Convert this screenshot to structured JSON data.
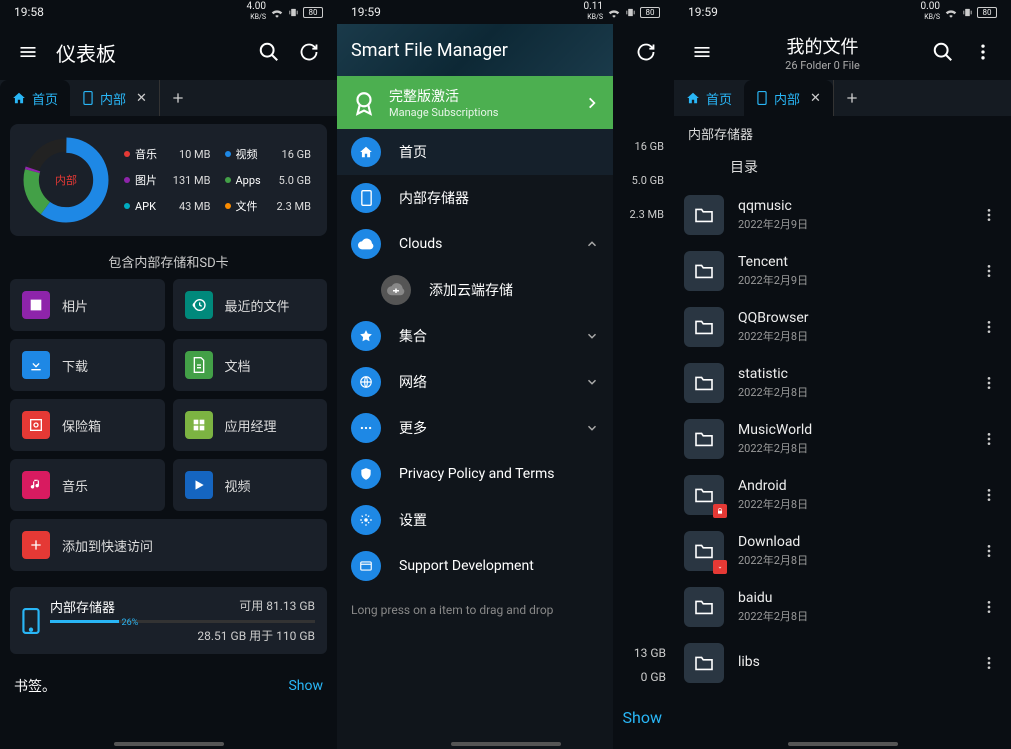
{
  "s1": {
    "status": {
      "time": "19:58",
      "net": "4.00",
      "net_unit": "KB/S",
      "batt": "80"
    },
    "title": "仪表板",
    "tabs": [
      {
        "icon": "home",
        "label": "首页",
        "active": true
      },
      {
        "icon": "phone",
        "label": "内部",
        "closable": true
      }
    ],
    "donut_label": "内部",
    "legend": [
      {
        "color": "#e53935",
        "name": "音乐",
        "val": "10 MB"
      },
      {
        "color": "#1e88e5",
        "name": "视频",
        "val": "16 GB"
      },
      {
        "color": "#8e24aa",
        "name": "图片",
        "val": "131 MB"
      },
      {
        "color": "#43a047",
        "name": "Apps",
        "val": "5.0 GB"
      },
      {
        "color": "#00acc1",
        "name": "APK",
        "val": "43 MB"
      },
      {
        "color": "#fb8c00",
        "name": "文件",
        "val": "2.3 MB"
      }
    ],
    "section_title": "包含内部存储和SD卡",
    "tiles": [
      {
        "bg": "#8e24aa",
        "name": "相片",
        "icon": "image"
      },
      {
        "bg": "#00897b",
        "name": "最近的文件",
        "icon": "history"
      },
      {
        "bg": "#1e88e5",
        "name": "下载",
        "icon": "download"
      },
      {
        "bg": "#43a047",
        "name": "文档",
        "icon": "doc"
      },
      {
        "bg": "#e53935",
        "name": "保险箱",
        "icon": "safe"
      },
      {
        "bg": "#7cb342",
        "name": "应用经理",
        "icon": "apps"
      },
      {
        "bg": "#d81b60",
        "name": "音乐",
        "icon": "music"
      },
      {
        "bg": "#1565c0",
        "name": "视频",
        "icon": "play"
      },
      {
        "bg": "#e53935",
        "name": "添加到快速访问",
        "icon": "add",
        "full": true
      }
    ],
    "storage": {
      "title": "内部存储器",
      "avail": "可用 81.13 GB",
      "pct": 26,
      "pct_label": "26%",
      "used": "28.51 GB 用于 110 GB"
    },
    "bookmark_label": "书签。",
    "show": "Show"
  },
  "s2": {
    "status": {
      "time": "19:59",
      "net": "0.11",
      "net_unit": "KB/S",
      "batt": "80"
    },
    "header": "Smart File Manager",
    "banner": {
      "title": "完整版激活",
      "sub": "Manage Subscriptions"
    },
    "items": [
      {
        "type": "home",
        "label": "首页",
        "sel": true,
        "color": "#1e88e5"
      },
      {
        "type": "phone",
        "label": "内部存储器",
        "color": "#1e88e5"
      },
      {
        "type": "cloud",
        "label": "Clouds",
        "color": "#1e88e5",
        "expand": "up"
      },
      {
        "type": "cloud-add",
        "label": "添加云端存储",
        "sub": true,
        "color": "#555"
      },
      {
        "type": "collection",
        "label": "集合",
        "color": "#1e88e5",
        "expand": "down"
      },
      {
        "type": "network",
        "label": "网络",
        "color": "#1e88e5",
        "expand": "down"
      },
      {
        "type": "more",
        "label": "更多",
        "color": "#1e88e5",
        "expand": "down"
      },
      {
        "type": "privacy",
        "label": "Privacy Policy and Terms",
        "color": "#1e88e5"
      },
      {
        "type": "settings",
        "label": "设置",
        "color": "#1e88e5"
      },
      {
        "type": "support",
        "label": "Support Development",
        "color": "#1e88e5"
      }
    ],
    "hint": "Long press on a item to drag and drop",
    "right_vals": [
      "16 GB",
      "5.0 GB",
      "2.3 MB"
    ],
    "right_storage": [
      "13 GB",
      "0 GB"
    ],
    "right_show": "Show"
  },
  "s3": {
    "status": {
      "time": "19:59",
      "net": "0.00",
      "net_unit": "KB/S",
      "batt": "80"
    },
    "title": "我的文件",
    "subtitle": "26 Folder 0 File",
    "tabs": [
      {
        "icon": "home",
        "label": "首页"
      },
      {
        "icon": "phone",
        "label": "内部",
        "active": true,
        "closable": true
      }
    ],
    "crumb": "内部存储器",
    "list_header": "目录",
    "folders": [
      {
        "name": "qqmusic",
        "date": "2022年2月9日"
      },
      {
        "name": "Tencent",
        "date": "2022年2月9日"
      },
      {
        "name": "QQBrowser",
        "date": "2022年2月8日"
      },
      {
        "name": "statistic",
        "date": "2022年2月8日"
      },
      {
        "name": "MusicWorld",
        "date": "2022年2月8日"
      },
      {
        "name": "Android",
        "date": "2022年2月8日",
        "badge": "lock"
      },
      {
        "name": "Download",
        "date": "2022年2月8日",
        "badge": "down"
      },
      {
        "name": "baidu",
        "date": "2022年2月8日"
      },
      {
        "name": "libs",
        "date": ""
      }
    ]
  },
  "chart_data": {
    "type": "pie",
    "title": "内部",
    "series": [
      {
        "name": "音乐",
        "value_label": "10 MB",
        "value_mb": 10,
        "color": "#e53935"
      },
      {
        "name": "视频",
        "value_label": "16 GB",
        "value_mb": 16384,
        "color": "#1e88e5"
      },
      {
        "name": "图片",
        "value_label": "131 MB",
        "value_mb": 131,
        "color": "#8e24aa"
      },
      {
        "name": "Apps",
        "value_label": "5.0 GB",
        "value_mb": 5120,
        "color": "#43a047"
      },
      {
        "name": "APK",
        "value_label": "43 MB",
        "value_mb": 43,
        "color": "#00acc1"
      },
      {
        "name": "文件",
        "value_label": "2.3 MB",
        "value_mb": 2.3,
        "color": "#fb8c00"
      }
    ],
    "total_label": "28.51 GB 用于 110 GB",
    "free_label": "可用 81.13 GB"
  }
}
